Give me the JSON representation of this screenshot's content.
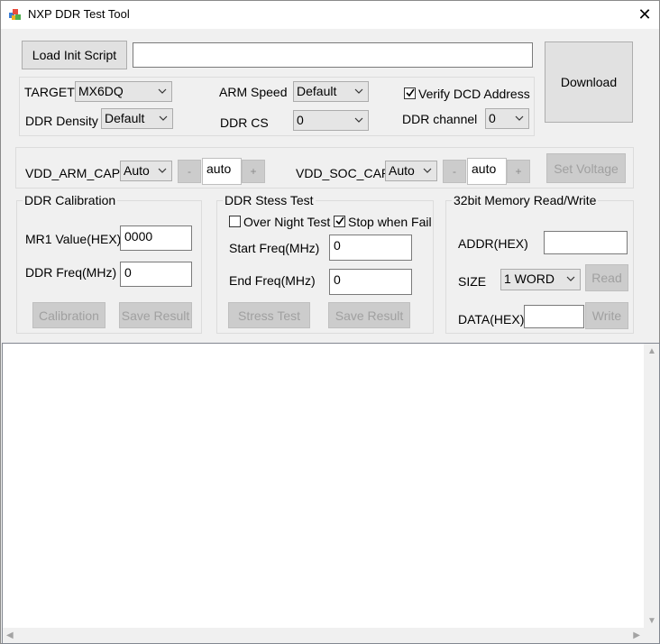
{
  "window": {
    "title": "NXP DDR Test Tool",
    "close_glyph": "✕"
  },
  "init": {
    "load_label": "Load Init Script",
    "script_path": "",
    "download_label": "Download"
  },
  "config": {
    "target_label": "TARGET",
    "target_value": "MX6DQ",
    "arm_speed_label": "ARM Speed",
    "arm_speed_value": "Default",
    "verify_dcd_label": "Verify DCD Address",
    "verify_dcd_checked": true,
    "ddr_density_label": "DDR Density",
    "ddr_density_value": "Default",
    "ddr_cs_label": "DDR CS",
    "ddr_cs_value": "0",
    "ddr_channel_label": "DDR channel",
    "ddr_channel_value": "0"
  },
  "voltage": {
    "arm_cap_label": "VDD_ARM_CAP",
    "arm_cap_value": "Auto",
    "arm_minus": "-",
    "arm_value": "auto",
    "arm_plus": "+",
    "soc_cap_label": "VDD_SOC_CAP",
    "soc_cap_value": "Auto",
    "soc_minus": "-",
    "soc_value": "auto",
    "soc_plus": "+",
    "set_voltage_label": "Set Voltage"
  },
  "calibration": {
    "legend": "DDR Calibration",
    "mr1_label": "MR1 Value(HEX)",
    "mr1_value": "0000",
    "freq_label": "DDR Freq(MHz)",
    "freq_value": "0",
    "calibration_label": "Calibration",
    "save_label": "Save Result"
  },
  "stress": {
    "legend": "DDR Stess Test",
    "overnight_label": "Over Night Test",
    "overnight_checked": false,
    "stopfail_label": "Stop when Fail",
    "stopfail_checked": true,
    "start_label": "Start Freq(MHz)",
    "start_value": "0",
    "end_label": "End Freq(MHz)",
    "end_value": "0",
    "stress_label": "Stress Test",
    "save_label": "Save Result"
  },
  "memory": {
    "legend": "32bit Memory Read/Write",
    "addr_label": "ADDR(HEX)",
    "addr_value": "",
    "size_label": "SIZE",
    "size_value": "1 WORD",
    "read_label": "Read",
    "data_label": "DATA(HEX)",
    "data_value": "",
    "write_label": "Write"
  },
  "log": {
    "text": ""
  }
}
